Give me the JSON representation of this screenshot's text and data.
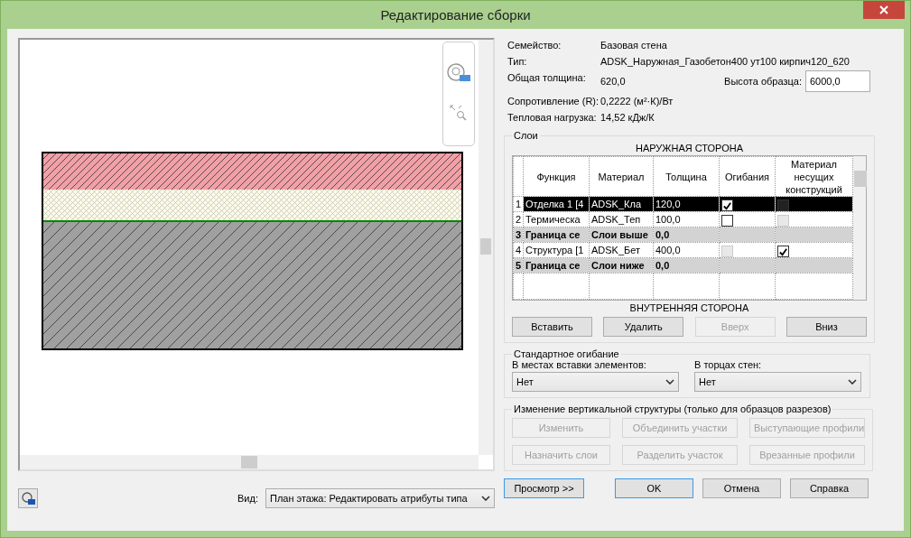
{
  "window": {
    "title": "Редактирование сборки"
  },
  "view": {
    "label": "Вид:",
    "value": "План этажа: Редактировать атрибуты типа"
  },
  "info": [
    {
      "label": "Семейство:",
      "value": "Базовая стена"
    },
    {
      "label": "Тип:",
      "value": "ADSK_Наружная_Газобетон400 ут100 кирпич120_620"
    },
    {
      "label": "Общая толщина:",
      "value": "620,0"
    },
    {
      "label": "Сопротивление (R):",
      "value": "0,2222 (м²·К)/Вт"
    },
    {
      "label": "Тепловая нагрузка:",
      "value": "14,52 кДж/К"
    }
  ],
  "sample_height": {
    "label": "Высота образца:",
    "value": "6000,0"
  },
  "layers": {
    "title": "Слои",
    "top_caption": "НАРУЖНАЯ СТОРОНА",
    "bottom_caption": "ВНУТРЕННЯЯ СТОРОНА",
    "columns": [
      "Функция",
      "Материал",
      "Толщина",
      "Огибания",
      "Материал несущих конструкций"
    ],
    "rows": [
      {
        "kind": "layer",
        "num": "1",
        "function": "Отделка 1 [4",
        "material": "ADSK_Кла",
        "thickness": "120,0",
        "selected": true,
        "wraps": {
          "checked": true,
          "disabled": false
        },
        "structural": {
          "checked": false,
          "disabled": true
        }
      },
      {
        "kind": "layer",
        "num": "2",
        "function": "Термическа",
        "material": "ADSK_Теп",
        "thickness": "100,0",
        "selected": false,
        "wraps": {
          "checked": false,
          "disabled": false
        },
        "structural": {
          "checked": false,
          "disabled": true
        }
      },
      {
        "kind": "boundary",
        "num": "3",
        "function": "Граница се",
        "material": "Слои выше",
        "thickness": "0,0",
        "selected": false
      },
      {
        "kind": "layer",
        "num": "4",
        "function": "Структура [1",
        "material": "ADSK_Бет",
        "thickness": "400,0",
        "selected": false,
        "wraps": {
          "checked": false,
          "disabled": true
        },
        "structural": {
          "checked": true,
          "disabled": false
        }
      },
      {
        "kind": "boundary",
        "num": "5",
        "function": "Граница се",
        "material": "Слои ниже",
        "thickness": "0,0",
        "selected": false
      }
    ],
    "buttons": [
      {
        "label": "Вставить",
        "disabled": false
      },
      {
        "label": "Удалить",
        "disabled": false
      },
      {
        "label": "Вверх",
        "disabled": true
      },
      {
        "label": "Вниз",
        "disabled": false
      }
    ]
  },
  "wrapping": {
    "title": "Стандартное огибание",
    "fields": [
      {
        "label": "В местах вставки элементов:",
        "value": "Нет"
      },
      {
        "label": "В торцах стен:",
        "value": "Нет"
      }
    ]
  },
  "vertical": {
    "title": "Изменение вертикальной структуры (только для образцов разрезов)",
    "buttons": [
      {
        "label": "Изменить",
        "disabled": true
      },
      {
        "label": "Объединить участки",
        "disabled": true
      },
      {
        "label": "Выступающие профили",
        "disabled": true
      },
      {
        "label": "Назначить слои",
        "disabled": true
      },
      {
        "label": "Разделить участок",
        "disabled": true
      },
      {
        "label": "Врезанные профили",
        "disabled": true
      }
    ]
  },
  "footer": {
    "preview": "Просмотр >>",
    "buttons": [
      {
        "label": "OK",
        "default": true
      },
      {
        "label": "Отмена",
        "default": false
      },
      {
        "label": "Справка",
        "default": false
      }
    ]
  }
}
